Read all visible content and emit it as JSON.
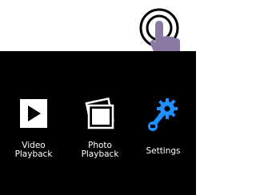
{
  "gesture": {
    "icon": "tap-gesture-icon",
    "finger_color": "#8c7aa3"
  },
  "menu": {
    "items": [
      {
        "label": "Video\nPlayback",
        "icon": "play-icon"
      },
      {
        "label": "Photo\nPlayback",
        "icon": "photos-icon"
      },
      {
        "label": "Settings",
        "icon": "settings-wrench-gear-icon",
        "accent": "#1e90ff"
      }
    ]
  }
}
